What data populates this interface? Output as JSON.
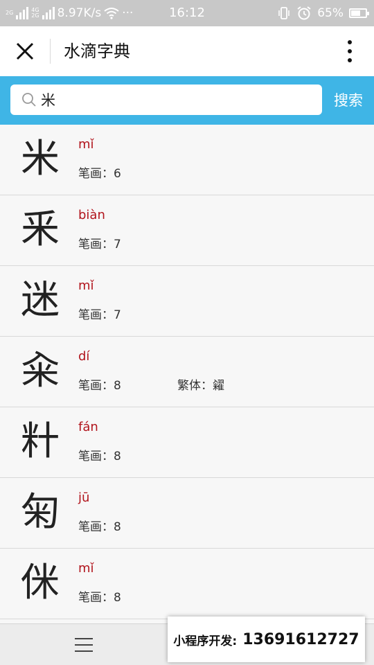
{
  "status_bar": {
    "network_2g": "2G",
    "network_4g": "4G",
    "network_2g_b": "2G",
    "speed": "8.97K/s",
    "dots": "···",
    "time": "16:12",
    "battery": "65%",
    "battery_level": 0.65
  },
  "nav": {
    "title": "水滴字典"
  },
  "search": {
    "value": "米",
    "button_label": "搜索"
  },
  "results": [
    {
      "char": "米",
      "pinyin": "mǐ",
      "strokes": "笔画：6",
      "traditional": ""
    },
    {
      "char": "釆",
      "pinyin": "biàn",
      "strokes": "笔画：7",
      "traditional": ""
    },
    {
      "char": "迷",
      "pinyin": "mǐ",
      "strokes": "笔画：7",
      "traditional": ""
    },
    {
      "char": "籴",
      "pinyin": "dí",
      "strokes": "笔画：8",
      "traditional": "繁体：糴"
    },
    {
      "char": "籵",
      "pinyin": "fán",
      "strokes": "笔画：8",
      "traditional": ""
    },
    {
      "char": "匊",
      "pinyin": "jū",
      "strokes": "笔画：8",
      "traditional": ""
    },
    {
      "char": "侎",
      "pinyin": "mǐ",
      "strokes": "笔画：8",
      "traditional": ""
    }
  ],
  "promo": {
    "label": "小程序开发:",
    "phone": "13691612727"
  },
  "colors": {
    "accent": "#3fb5e6",
    "pinyin": "#b1141c"
  }
}
